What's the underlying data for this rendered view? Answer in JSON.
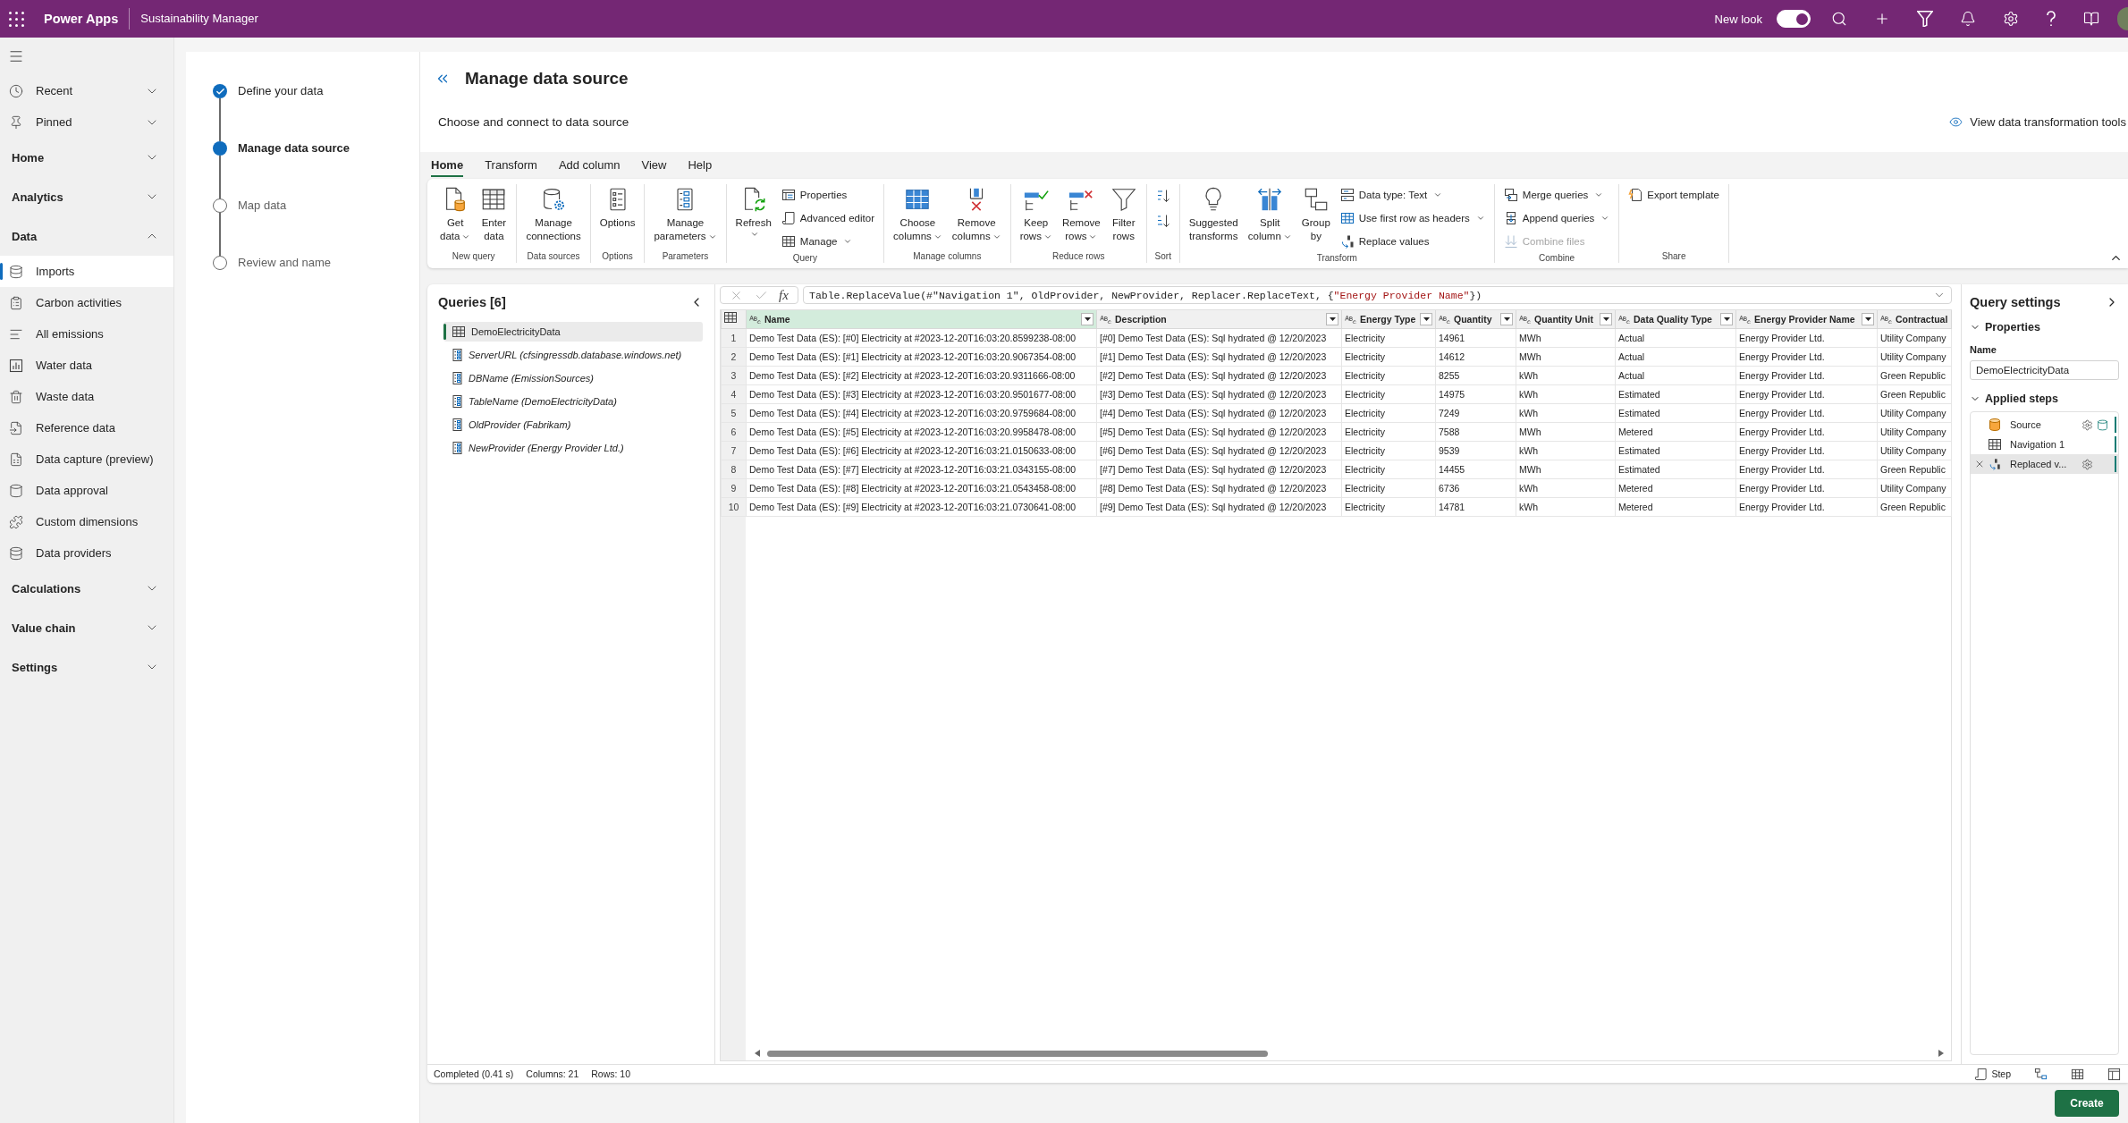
{
  "top_bar": {
    "app_name": "Power Apps",
    "environment": "Sustainability Manager",
    "new_look": {
      "label": "New look",
      "on": true
    }
  },
  "nav": [
    {
      "kind": "flyout",
      "label": "Recent",
      "expanded": false
    },
    {
      "kind": "flyout",
      "label": "Pinned",
      "expanded": false
    },
    {
      "kind": "section",
      "label": "Home",
      "expanded": false
    },
    {
      "kind": "section",
      "label": "Analytics",
      "expanded": false
    },
    {
      "kind": "section",
      "label": "Data",
      "expanded": true,
      "children": [
        {
          "label": "Imports",
          "selected": true
        },
        {
          "label": "Carbon activities",
          "selected": false
        },
        {
          "label": "All emissions",
          "selected": false
        },
        {
          "label": "Water data",
          "selected": false
        },
        {
          "label": "Waste data",
          "selected": false
        },
        {
          "label": "Reference data",
          "selected": false
        },
        {
          "label": "Data capture (preview)",
          "selected": false
        },
        {
          "label": "Data approval",
          "selected": false
        },
        {
          "label": "Custom dimensions",
          "selected": false
        },
        {
          "label": "Data providers",
          "selected": false
        }
      ]
    },
    {
      "kind": "section",
      "label": "Calculations",
      "expanded": false
    },
    {
      "kind": "section",
      "label": "Value chain",
      "expanded": false
    },
    {
      "kind": "section",
      "label": "Settings",
      "expanded": false
    }
  ],
  "steps": [
    {
      "label": "Define your data",
      "done": true,
      "selected": false
    },
    {
      "label": "Manage data source",
      "done": false,
      "selected": true
    },
    {
      "label": "Map data",
      "done": false,
      "selected": false
    },
    {
      "label": "Review and name",
      "done": false,
      "selected": false
    }
  ],
  "header": {
    "title": "Manage data source",
    "subtitle": "Choose and connect to data source",
    "link": "View data transformation tools"
  },
  "ribbon": {
    "tabs": [
      {
        "label": "Home",
        "selected": true
      },
      {
        "label": "Transform",
        "selected": false
      },
      {
        "label": "Add column",
        "selected": false
      },
      {
        "label": "View",
        "selected": false
      },
      {
        "label": "Help",
        "selected": false
      }
    ],
    "groups": [
      {
        "label": "New query",
        "buttons": [
          {
            "kind": "large",
            "label": "Get data",
            "dropdown": true,
            "disabled": false
          },
          {
            "kind": "large",
            "label": "Enter data",
            "dropdown": false,
            "disabled": false
          }
        ]
      },
      {
        "label": "Data sources",
        "buttons": [
          {
            "kind": "large",
            "label": "Manage connections",
            "dropdown": false,
            "disabled": false
          }
        ]
      },
      {
        "label": "Options",
        "buttons": [
          {
            "kind": "large",
            "label": "Options",
            "dropdown": false,
            "disabled": false
          }
        ]
      },
      {
        "label": "Parameters",
        "buttons": [
          {
            "kind": "large",
            "label": "Manage parameters",
            "dropdown": true,
            "disabled": false
          }
        ]
      },
      {
        "label": "Query",
        "buttons": [
          {
            "kind": "large",
            "label": "Refresh",
            "dropdown": true,
            "disabled": false
          },
          {
            "kind": "small",
            "label": "Properties",
            "dropdown": false,
            "disabled": false
          },
          {
            "kind": "small",
            "label": "Advanced editor",
            "dropdown": false,
            "disabled": false
          },
          {
            "kind": "small",
            "label": "Manage",
            "dropdown": true,
            "disabled": false
          }
        ]
      },
      {
        "label": "Manage columns",
        "buttons": [
          {
            "kind": "large",
            "label": "Choose columns",
            "dropdown": true,
            "disabled": false
          },
          {
            "kind": "large",
            "label": "Remove columns",
            "dropdown": true,
            "disabled": false
          }
        ]
      },
      {
        "label": "Reduce rows",
        "buttons": [
          {
            "kind": "large",
            "label": "Keep rows",
            "dropdown": true,
            "disabled": false
          },
          {
            "kind": "large",
            "label": "Remove rows",
            "dropdown": true,
            "disabled": false
          },
          {
            "kind": "large",
            "label": "Filter rows",
            "dropdown": false,
            "disabled": false
          }
        ]
      },
      {
        "label": "Sort",
        "buttons": [
          {
            "kind": "icon",
            "disabled": false
          },
          {
            "kind": "icon",
            "disabled": false
          }
        ]
      },
      {
        "label": "Transform",
        "buttons": [
          {
            "kind": "large",
            "label": "Suggested transforms",
            "dropdown": false,
            "disabled": false
          },
          {
            "kind": "large",
            "label": "Split column",
            "dropdown": true,
            "disabled": false
          },
          {
            "kind": "large",
            "label": "Group by",
            "dropdown": false,
            "disabled": false
          },
          {
            "kind": "small",
            "label": "Data type: Text",
            "dropdown": true,
            "disabled": false
          },
          {
            "kind": "small",
            "label": "Use first row as headers",
            "dropdown": true,
            "disabled": false
          },
          {
            "kind": "small",
            "label": "Replace values",
            "dropdown": false,
            "disabled": false
          }
        ]
      },
      {
        "label": "Combine",
        "buttons": [
          {
            "kind": "small",
            "label": "Merge queries",
            "dropdown": true,
            "disabled": false
          },
          {
            "kind": "small",
            "label": "Append queries",
            "dropdown": true,
            "disabled": false
          },
          {
            "kind": "small",
            "label": "Combine files",
            "dropdown": false,
            "disabled": true
          }
        ]
      },
      {
        "label": "Share",
        "buttons": [
          {
            "kind": "small",
            "label": "Export template",
            "dropdown": false,
            "disabled": false
          }
        ]
      }
    ]
  },
  "queries": {
    "title": "Queries [6]",
    "items": [
      {
        "name": "DemoElectricityData",
        "kind": "table",
        "selected": true
      },
      {
        "name": "ServerURL (cfsingressdb.database.windows.net)",
        "kind": "parameter",
        "selected": false
      },
      {
        "name": "DBName (EmissionSources)",
        "kind": "parameter",
        "selected": false
      },
      {
        "name": "TableName (DemoElectricityData)",
        "kind": "parameter",
        "selected": false
      },
      {
        "name": "OldProvider (Fabrikam)",
        "kind": "parameter",
        "selected": false
      },
      {
        "name": "NewProvider (Energy Provider Ltd.)",
        "kind": "parameter",
        "selected": false
      }
    ]
  },
  "formula_bar": {
    "fx": "fx",
    "tokens": [
      {
        "kind": "code",
        "text": "Table.ReplaceValue(#\"Navigation 1\", OldProvider, NewProvider, Replacer.ReplaceText, {"
      },
      {
        "kind": "string",
        "text": "\"Energy Provider Name\""
      },
      {
        "kind": "code",
        "text": "})"
      }
    ]
  },
  "table": {
    "columns": [
      {
        "name": "Name",
        "selected": true
      },
      {
        "name": "Description",
        "selected": false
      },
      {
        "name": "Energy Type",
        "selected": false
      },
      {
        "name": "Quantity",
        "selected": false
      },
      {
        "name": "Quantity Unit",
        "selected": false
      },
      {
        "name": "Data Quality Type",
        "selected": false
      },
      {
        "name": "Energy Provider Name",
        "selected": false
      },
      {
        "name": "Contractual",
        "selected": false
      }
    ],
    "rows": [
      {
        "number": "1",
        "cells": [
          "Demo Test Data (ES): [#0] Electricity at #2023-12-20T16:03:20.8599238-08:00",
          "[#0] Demo Test Data (ES): Sql hydrated @ 12/20/2023",
          "Electricity",
          "14961",
          "MWh",
          "Actual",
          "Energy Provider Ltd.",
          "Utility Company"
        ]
      },
      {
        "number": "2",
        "cells": [
          "Demo Test Data (ES): [#1] Electricity at #2023-12-20T16:03:20.9067354-08:00",
          "[#1] Demo Test Data (ES): Sql hydrated @ 12/20/2023",
          "Electricity",
          "14612",
          "MWh",
          "Actual",
          "Energy Provider Ltd.",
          "Utility Company"
        ]
      },
      {
        "number": "3",
        "cells": [
          "Demo Test Data (ES): [#2] Electricity at #2023-12-20T16:03:20.9311666-08:00",
          "[#2] Demo Test Data (ES): Sql hydrated @ 12/20/2023",
          "Electricity",
          "8255",
          "kWh",
          "Actual",
          "Energy Provider Ltd.",
          "Green Republic"
        ]
      },
      {
        "number": "4",
        "cells": [
          "Demo Test Data (ES): [#3] Electricity at #2023-12-20T16:03:20.9501677-08:00",
          "[#3] Demo Test Data (ES): Sql hydrated @ 12/20/2023",
          "Electricity",
          "14975",
          "kWh",
          "Estimated",
          "Energy Provider Ltd.",
          "Green Republic"
        ]
      },
      {
        "number": "5",
        "cells": [
          "Demo Test Data (ES): [#4] Electricity at #2023-12-20T16:03:20.9759684-08:00",
          "[#4] Demo Test Data (ES): Sql hydrated @ 12/20/2023",
          "Electricity",
          "7249",
          "kWh",
          "Estimated",
          "Energy Provider Ltd.",
          "Utility Company"
        ]
      },
      {
        "number": "6",
        "cells": [
          "Demo Test Data (ES): [#5] Electricity at #2023-12-20T16:03:20.9958478-08:00",
          "[#5] Demo Test Data (ES): Sql hydrated @ 12/20/2023",
          "Electricity",
          "7588",
          "MWh",
          "Metered",
          "Energy Provider Ltd.",
          "Utility Company"
        ]
      },
      {
        "number": "7",
        "cells": [
          "Demo Test Data (ES): [#6] Electricity at #2023-12-20T16:03:21.0150633-08:00",
          "[#6] Demo Test Data (ES): Sql hydrated @ 12/20/2023",
          "Electricity",
          "9539",
          "kWh",
          "Estimated",
          "Energy Provider Ltd.",
          "Utility Company"
        ]
      },
      {
        "number": "8",
        "cells": [
          "Demo Test Data (ES): [#7] Electricity at #2023-12-20T16:03:21.0343155-08:00",
          "[#7] Demo Test Data (ES): Sql hydrated @ 12/20/2023",
          "Electricity",
          "14455",
          "MWh",
          "Estimated",
          "Energy Provider Ltd.",
          "Green Republic"
        ]
      },
      {
        "number": "9",
        "cells": [
          "Demo Test Data (ES): [#8] Electricity at #2023-12-20T16:03:21.0543458-08:00",
          "[#8] Demo Test Data (ES): Sql hydrated @ 12/20/2023",
          "Electricity",
          "6736",
          "kWh",
          "Metered",
          "Energy Provider Ltd.",
          "Utility Company"
        ]
      },
      {
        "number": "10",
        "cells": [
          "Demo Test Data (ES): [#9] Electricity at #2023-12-20T16:03:21.0730641-08:00",
          "[#9] Demo Test Data (ES): Sql hydrated @ 12/20/2023",
          "Electricity",
          "14781",
          "kWh",
          "Metered",
          "Energy Provider Ltd.",
          "Green Republic"
        ]
      }
    ]
  },
  "query_settings": {
    "title": "Query settings",
    "properties": {
      "label": "Properties",
      "expanded": true,
      "name_field": {
        "label": "Name",
        "value": "DemoElectricityData"
      }
    },
    "applied_steps": {
      "label": "Applied steps",
      "expanded": true,
      "steps": [
        {
          "name": "Source",
          "selected": false,
          "deletable": false,
          "settings": true,
          "native_query": true
        },
        {
          "name": "Navigation 1",
          "selected": false,
          "deletable": false,
          "settings": false,
          "native_query": false
        },
        {
          "name": "Replaced v...",
          "selected": true,
          "deletable": true,
          "settings": true,
          "native_query": false
        }
      ]
    }
  },
  "status_bar": {
    "items": [
      "Completed (0.41 s)",
      "Columns: 21",
      "Rows: 10"
    ],
    "step_button": "Step"
  },
  "create_button": {
    "label": "Create"
  }
}
